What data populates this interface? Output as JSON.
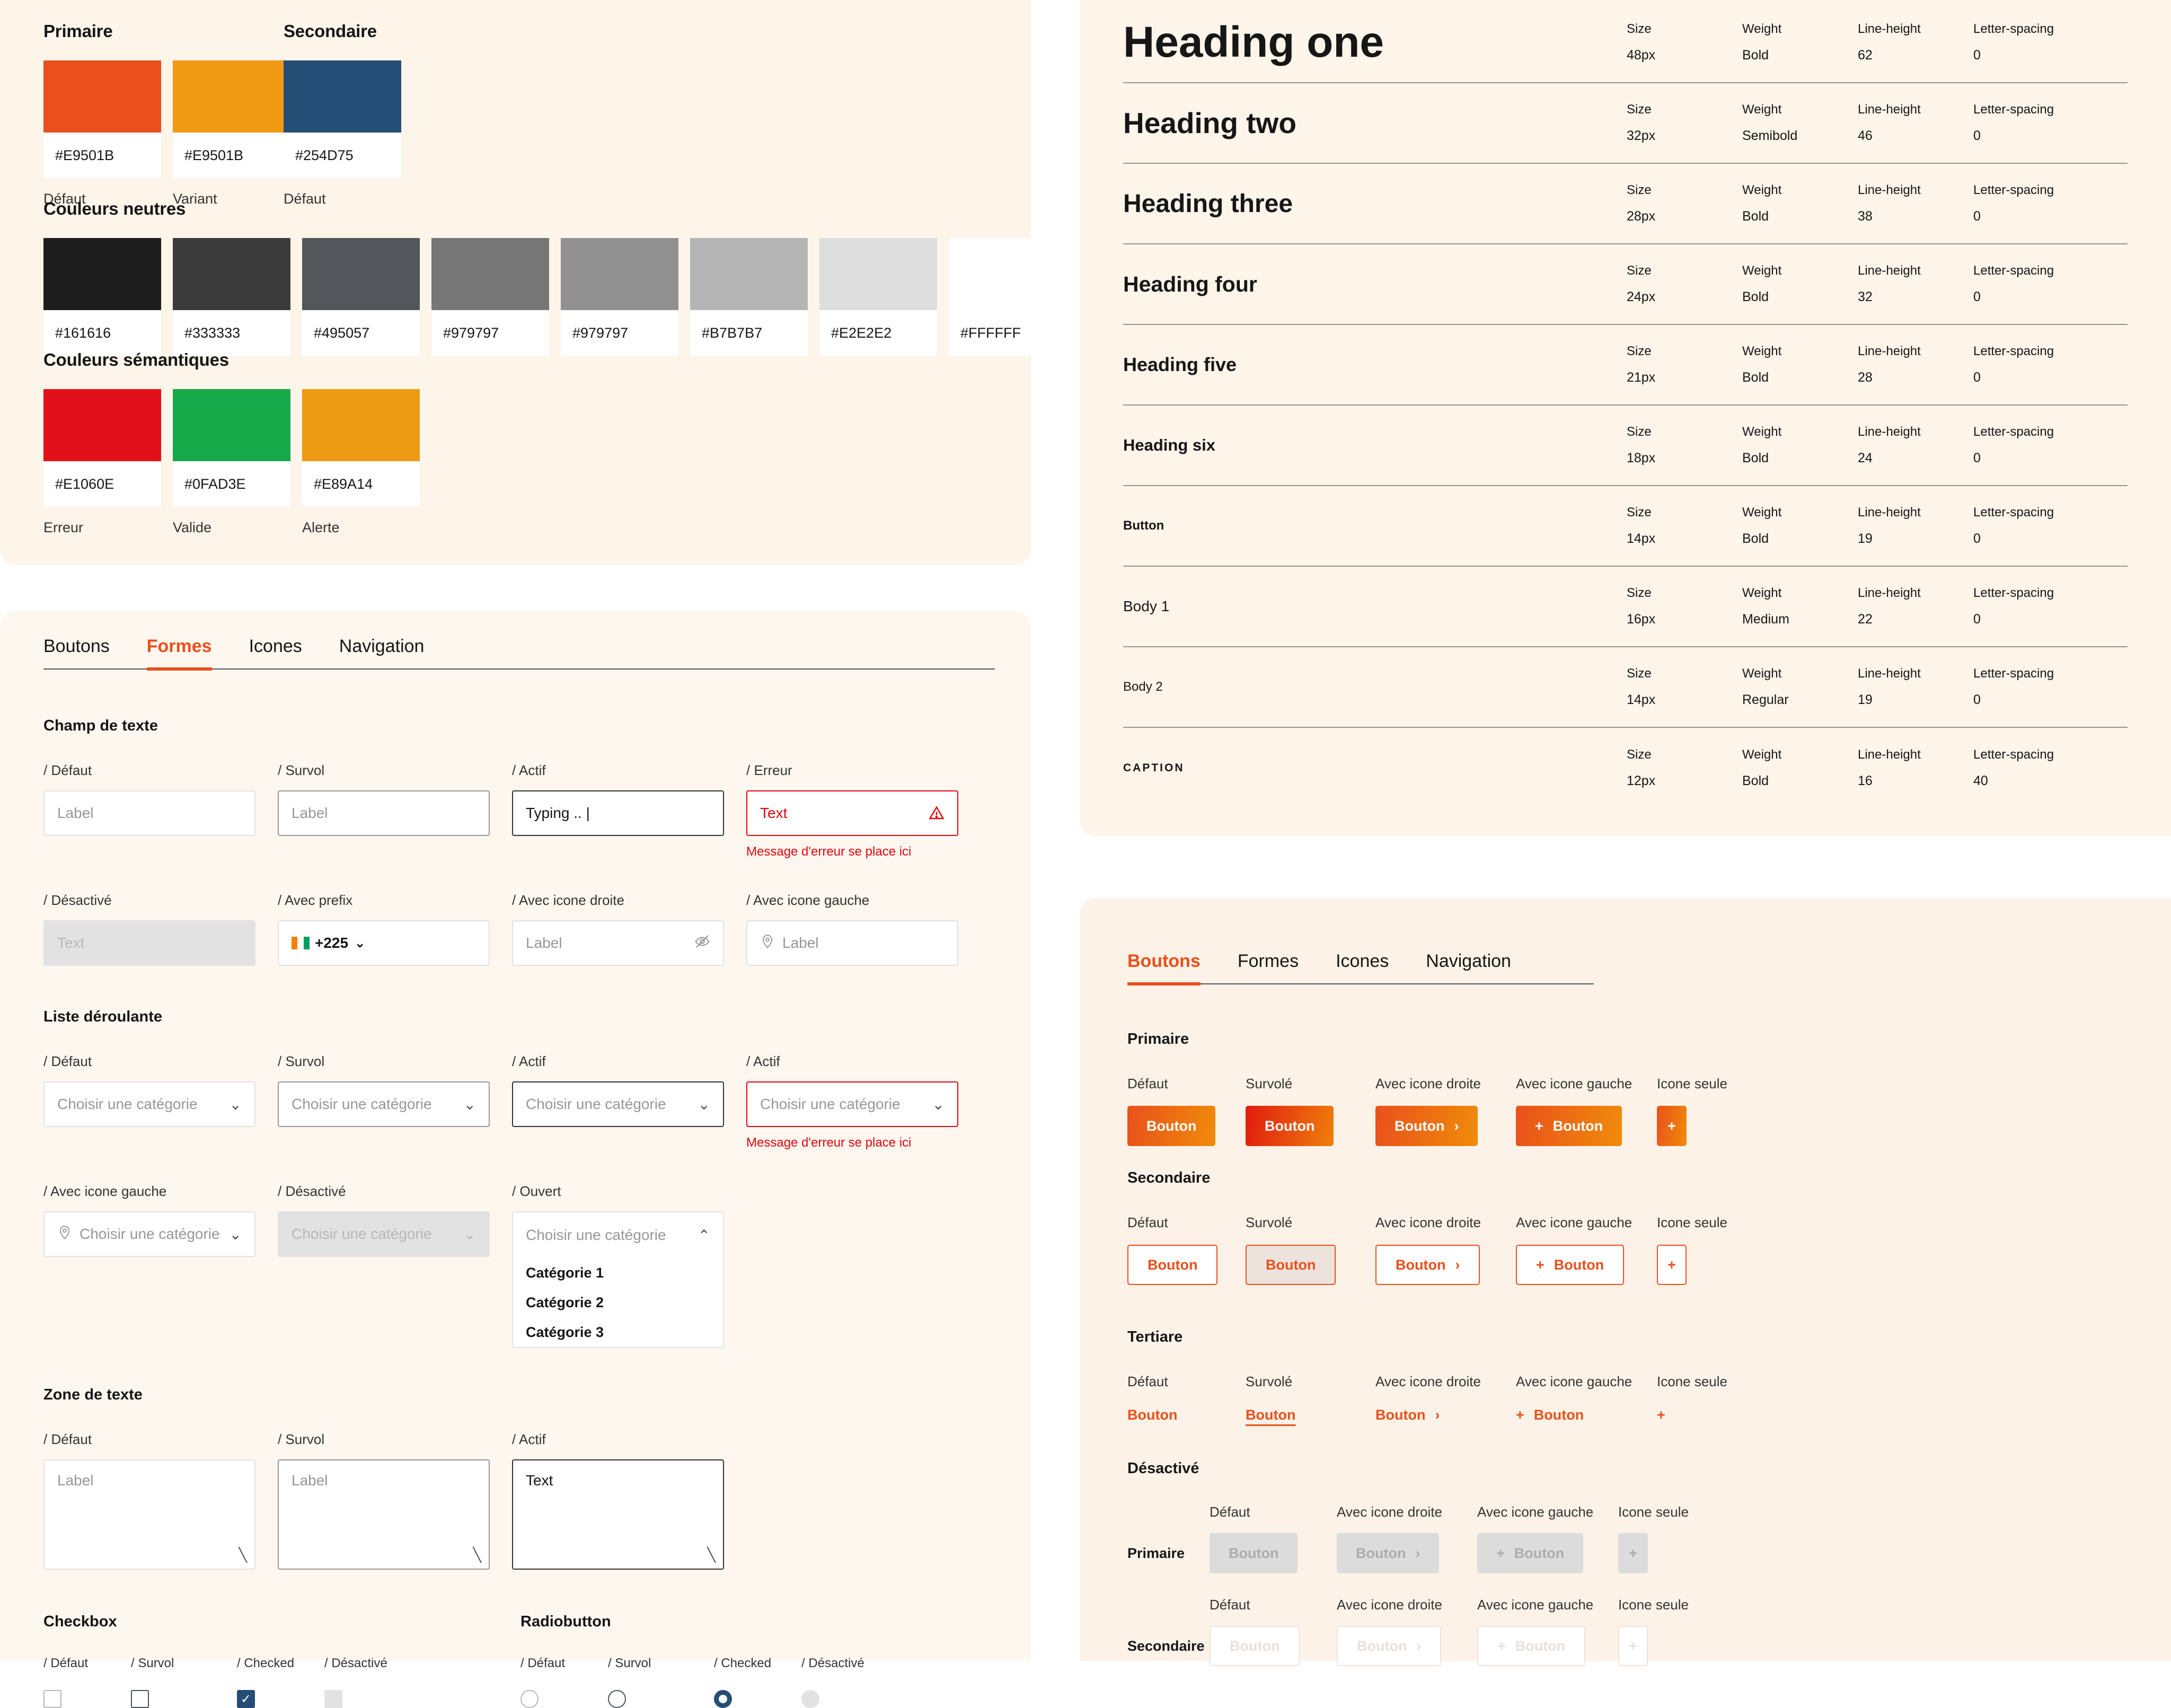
{
  "colors_panel": {
    "primary": {
      "title": "Primaire",
      "swatches": [
        {
          "hex": "#E9501B",
          "caption": "Défaut",
          "color": "#E9501B"
        },
        {
          "hex": "#E9501B",
          "caption": "Variant",
          "color": "#F09A14"
        }
      ]
    },
    "secondary": {
      "title": "Secondaire",
      "swatches": [
        {
          "hex": "#254D75",
          "caption": "Défaut",
          "color": "#254D75"
        }
      ]
    },
    "neutral": {
      "title": "Couleurs neutres",
      "swatches": [
        {
          "hex": "#161616",
          "color": "#1d1d1d"
        },
        {
          "hex": "#333333",
          "color": "#3b3b3b"
        },
        {
          "hex": "#495057",
          "color": "#53565a"
        },
        {
          "hex": "#979797",
          "color": "#767676"
        },
        {
          "hex": "#979797",
          "color": "#909090"
        },
        {
          "hex": "#B7B7B7",
          "color": "#b5b5b5"
        },
        {
          "hex": "#E2E2E2",
          "color": "#dedede"
        },
        {
          "hex": "#FFFFFF",
          "color": "#ffffff"
        }
      ]
    },
    "semantic": {
      "title": "Couleurs sémantiques",
      "swatches": [
        {
          "hex": "#E1060E",
          "caption": "Erreur",
          "color": "#e1101a"
        },
        {
          "hex": "#0FAD3E",
          "caption": "Valide",
          "color": "#16a94a"
        },
        {
          "hex": "#E89A14",
          "caption": "Alerte",
          "color": "#ed9a13"
        }
      ]
    }
  },
  "typography_panel": {
    "columns": [
      "Size",
      "Weight",
      "Line-height",
      "Letter-spacing"
    ],
    "rows": [
      {
        "name": "Heading one",
        "size": "48px",
        "weight": "Bold",
        "line_height": "62",
        "letter_spacing": "0"
      },
      {
        "name": "Heading two",
        "size": "32px",
        "weight": "Semibold",
        "line_height": "46",
        "letter_spacing": "0"
      },
      {
        "name": "Heading three",
        "size": "28px",
        "weight": "Bold",
        "line_height": "38",
        "letter_spacing": "0"
      },
      {
        "name": "Heading four",
        "size": "24px",
        "weight": "Bold",
        "line_height": "32",
        "letter_spacing": "0"
      },
      {
        "name": "Heading five",
        "size": "21px",
        "weight": "Bold",
        "line_height": "28",
        "letter_spacing": "0"
      },
      {
        "name": "Heading six",
        "size": "18px",
        "weight": "Bold",
        "line_height": "24",
        "letter_spacing": "0"
      },
      {
        "name": "Button",
        "size": "14px",
        "weight": "Bold",
        "line_height": "19",
        "letter_spacing": "0"
      },
      {
        "name": "Body 1",
        "size": "16px",
        "weight": "Medium",
        "line_height": "22",
        "letter_spacing": "0"
      },
      {
        "name": "Body 2",
        "size": "14px",
        "weight": "Regular",
        "line_height": "19",
        "letter_spacing": "0"
      },
      {
        "name": "CAPTION",
        "size": "12px",
        "weight": "Bold",
        "line_height": "16",
        "letter_spacing": "40"
      }
    ]
  },
  "forms_panel": {
    "tabs": [
      {
        "label": "Boutons",
        "active": false
      },
      {
        "label": "Formes",
        "active": true
      },
      {
        "label": "Icones",
        "active": false
      },
      {
        "label": "Navigation",
        "active": false
      }
    ],
    "text_field": {
      "title": "Champ de texte",
      "row1": [
        {
          "state": "/ Défaut",
          "value": "Label"
        },
        {
          "state": "/ Survol",
          "value": "Label"
        },
        {
          "state": "/ Actif",
          "value": "Typing .. |"
        },
        {
          "state": "/ Erreur",
          "value": "Text",
          "error_message": "Message d'erreur se place ici"
        }
      ],
      "row2": [
        {
          "state": "/ Désactivé",
          "value": "Text"
        },
        {
          "state": "/ Avec prefix",
          "value": "+225"
        },
        {
          "state": "/ Avec icone droite",
          "value": "Label"
        },
        {
          "state": "/ Avec icone gauche",
          "value": "Label"
        }
      ]
    },
    "dropdown": {
      "title": "Liste déroulante",
      "placeholder": "Choisir une catégorie",
      "row1": [
        {
          "state": "/ Défaut"
        },
        {
          "state": "/ Survol"
        },
        {
          "state": "/ Actif"
        },
        {
          "state": "/ Actif",
          "error_message": "Message d'erreur se place ici"
        }
      ],
      "row2": [
        {
          "state": "/ Avec icone gauche"
        },
        {
          "state": "/ Désactivé"
        },
        {
          "state": "/ Ouvert"
        }
      ],
      "options": [
        "Catégorie 1",
        "Catégorie 2",
        "Catégorie 3"
      ]
    },
    "textarea": {
      "title": "Zone de texte",
      "items": [
        {
          "state": "/ Défaut",
          "value": "Label"
        },
        {
          "state": "/ Survol",
          "value": "Label"
        },
        {
          "state": "/ Actif",
          "value": "Text"
        }
      ]
    },
    "checkbox": {
      "title": "Checkbox",
      "states": [
        "/ Défaut",
        "/ Survol",
        "/ Checked",
        "/ Désactivé"
      ]
    },
    "radiobutton": {
      "title": "Radiobutton",
      "states": [
        "/ Défaut",
        "/ Survol",
        "/ Checked",
        "/ Désactivé"
      ]
    }
  },
  "buttons_panel": {
    "tabs": [
      {
        "label": "Boutons",
        "active": true
      },
      {
        "label": "Formes",
        "active": false
      },
      {
        "label": "Icones",
        "active": false
      },
      {
        "label": "Navigation",
        "active": false
      }
    ],
    "button_label": "Bouton",
    "column_labels": [
      "Défaut",
      "Survolé",
      "Avec icone droite",
      "Avec icone gauche",
      "Icone seule"
    ],
    "disabled_column_labels": [
      "Défaut",
      "Avec icone droite",
      "Avec icone gauche",
      "Icone seule"
    ],
    "groups": [
      {
        "title": "Primaire"
      },
      {
        "title": "Secondaire"
      },
      {
        "title": "Tertiare"
      }
    ],
    "disabled": {
      "title": "Désactivé",
      "rows": [
        {
          "label": "Primaire"
        },
        {
          "label": "Secondaire"
        }
      ]
    }
  }
}
